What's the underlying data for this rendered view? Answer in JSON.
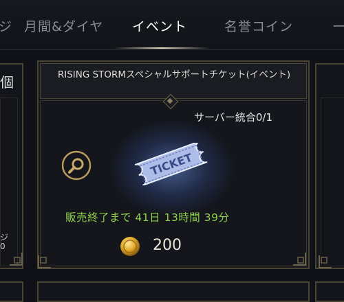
{
  "tabs": [
    {
      "label": "ジ"
    },
    {
      "label": "月間&ダイヤ"
    },
    {
      "label": "イベント",
      "active": true
    },
    {
      "label": "名誉コイン"
    },
    {
      "label": "一"
    }
  ],
  "left_card": {
    "label": "個",
    "bottom_text_1": "ジ",
    "bottom_text_2": "0"
  },
  "card": {
    "title": "RISING STORMスペシャルサポートチケット(イベント)",
    "server_limit": "サーバー統合0/1",
    "ticket_text": "TICKET",
    "timer": "販売終了まで  41日  13時間  39分",
    "price": "200"
  },
  "icons": {
    "search": "magnifier-icon",
    "coin": "gold-coin-icon",
    "ticket": "ticket-icon"
  },
  "colors": {
    "timer": "#8fd14a",
    "frame_gold": "#4a4435",
    "background": "#0f1116"
  }
}
